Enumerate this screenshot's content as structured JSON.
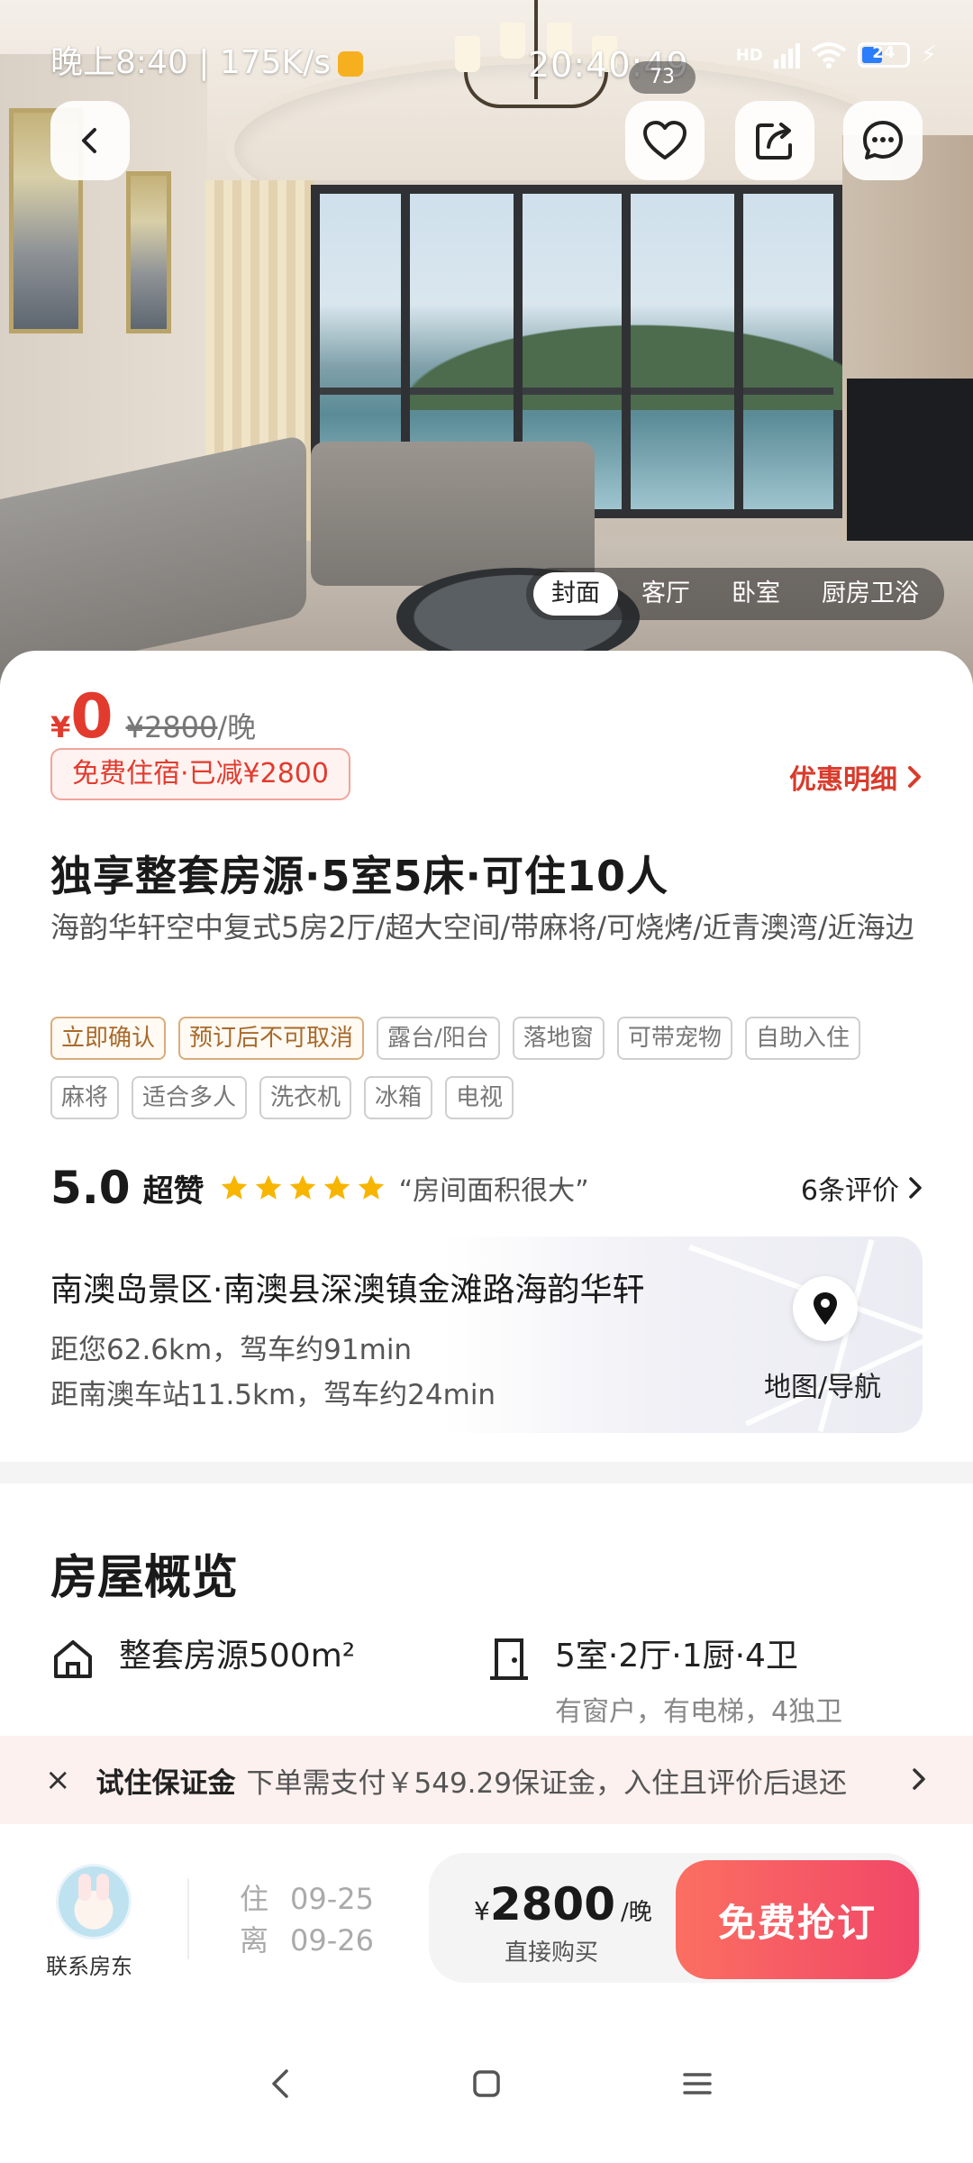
{
  "status_bar": {
    "left_text": "晚上8:40 | 175K/s",
    "clock": "20:40:49",
    "clock_badge": "73",
    "battery": "24"
  },
  "top_buttons": {
    "back": "back-icon",
    "favorite": "heart-icon",
    "share": "share-icon",
    "chat": "chat-icon"
  },
  "photo_tabs": [
    "封面",
    "客厅",
    "卧室",
    "厨房卫浴"
  ],
  "pricing": {
    "currency": "¥",
    "price": "0",
    "original": "¥2800",
    "per_night": "/晚",
    "promo": "免费住宿·已减¥2800",
    "detail_link": "优惠明细"
  },
  "listing": {
    "title": "独享整套房源·5室5床·可住10人",
    "subtitle": "海韵华轩空中复式5房2厅/超大空间/带麻将/可烧烤/近青澳湾/近海边",
    "tags_highlight": [
      "立即确认",
      "预订后不可取消"
    ],
    "tags": [
      "露台/阳台",
      "落地窗",
      "可带宠物",
      "自助入住",
      "麻将",
      "适合多人",
      "洗衣机",
      "冰箱",
      "电视"
    ]
  },
  "rating": {
    "score": "5.0",
    "level": "超赞",
    "stars": 5,
    "quote": "“房间面积很大”",
    "reviews": "6条评价"
  },
  "location": {
    "address": "南澳岛景区·南澳县深澳镇金滩路海韵华轩",
    "distance_user": "距您62.6km，驾车约91min",
    "distance_station": "距南澳车站11.5km，驾车约24min",
    "map_label": "地图/导航"
  },
  "overview": {
    "heading": "房屋概览",
    "area": "整套房源500m²",
    "rooms": "5室·2厅·1厨·4卫",
    "rooms_sub": "有窗户，有电梯，4独卫"
  },
  "deposit": {
    "close": "×",
    "label": "试住保证金",
    "desc": "下单需支付￥549.29保证金，入住且评价后退还"
  },
  "action_bar": {
    "host_label": "联系房东",
    "checkin_label": "住",
    "checkin_date": "09-25",
    "checkout_label": "离",
    "checkout_date": "09-26",
    "price_currency": "¥",
    "price": "2800",
    "price_unit": "/晚",
    "price_sub": "直接购买",
    "book_label": "免费抢订"
  },
  "colors": {
    "accent_red": "#e23b2e",
    "book_gradient_start": "#fb6f61",
    "book_gradient_end": "#f14668",
    "star_yellow": "#f7b500",
    "tag_orange": "#a86a2a"
  }
}
